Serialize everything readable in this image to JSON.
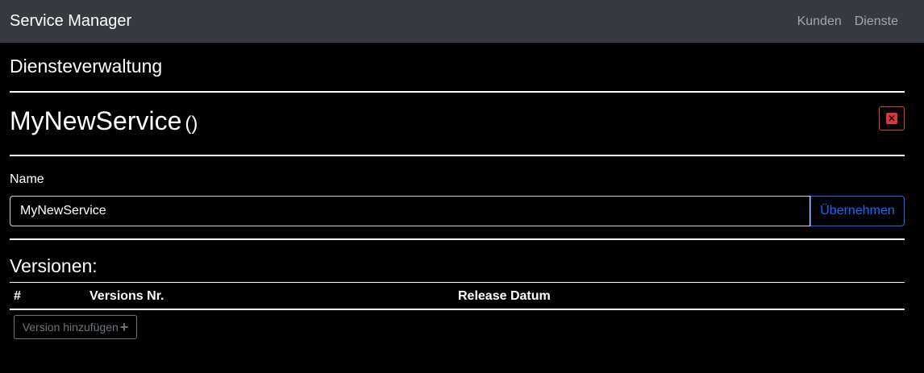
{
  "navbar": {
    "brand": "Service Manager",
    "links": [
      "Kunden",
      "Dienste"
    ]
  },
  "page": {
    "title": "Diensteverwaltung"
  },
  "service": {
    "name": "MyNewService",
    "subtitle": "()"
  },
  "form": {
    "name_label": "Name",
    "name_value": "MyNewService",
    "apply_label": "Übernehmen"
  },
  "versions": {
    "title": "Versionen:",
    "columns": [
      "#",
      "Versions Nr.",
      "Release Datum"
    ],
    "add_label": "Version hinzufügen"
  },
  "colors": {
    "navbar": "#343a40",
    "danger": "#dc3545",
    "primary": "#0d6efd",
    "secondary": "#6c757d"
  },
  "icons": {
    "delete": "close-box-icon",
    "add": "plus-icon"
  }
}
